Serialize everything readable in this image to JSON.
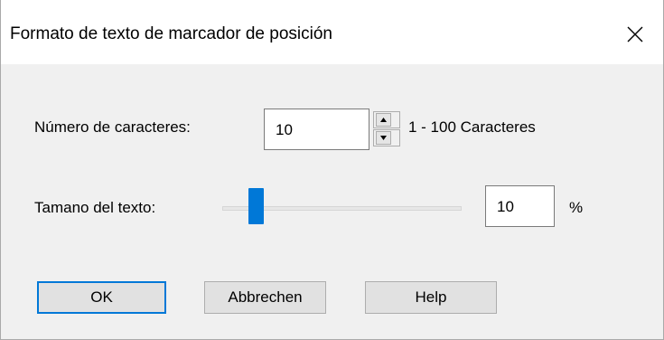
{
  "dialog": {
    "title": "Formato de texto de marcador de posición",
    "close_glyph": "✕"
  },
  "characters": {
    "label": "Número de caracteres:",
    "value": "10",
    "range_text": "1 - 100 Caracteres"
  },
  "text_size": {
    "label": "Tamano del texto:",
    "value": "10",
    "unit": "%",
    "slider_fraction": 0.1
  },
  "buttons": {
    "ok": "OK",
    "cancel": "Abbrechen",
    "help": "Help"
  },
  "colors": {
    "accent": "#0078d7",
    "dialog_background": "#f0f0f0",
    "button_background": "#e1e1e1"
  }
}
